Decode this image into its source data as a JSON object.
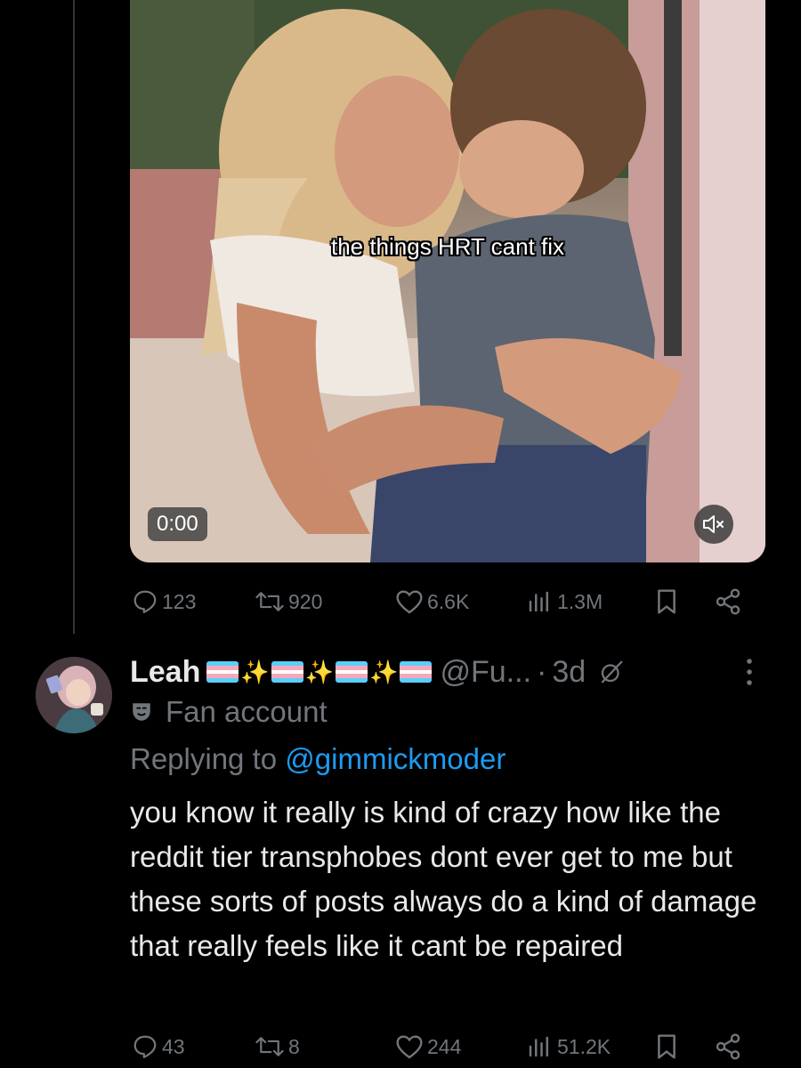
{
  "main_tweet": {
    "video": {
      "caption": "the things HRT cant fix",
      "timestamp": "0:00",
      "mute_icon": "speaker-muted-icon"
    },
    "actions": {
      "replies": "123",
      "reposts": "920",
      "likes": "6.6K",
      "views": "1.3M"
    }
  },
  "reply_tweet": {
    "display_name": "Leah",
    "name_emojis": [
      "trans-flag",
      "sparkles",
      "trans-flag",
      "sparkles",
      "trans-flag",
      "sparkles",
      "trans-flag"
    ],
    "handle": "@Fu...",
    "separator": "·",
    "time_ago": "3d",
    "account_label": "Fan account",
    "replying_prefix": "Replying to",
    "replying_to": "@gimmickmoder",
    "text": "you know it really is kind of crazy how like the reddit tier transphobes dont ever get to me but these sorts of posts always do a kind of damage that really feels like it cant be repaired",
    "actions": {
      "replies": "43",
      "reposts": "8",
      "likes": "244",
      "views": "51.2K"
    }
  },
  "colors": {
    "background": "#000000",
    "primary_text": "#e7e9ea",
    "secondary_text": "#71767b",
    "link": "#1d9bf0",
    "trans_blue": "#5bcefa",
    "trans_pink": "#f5a9b8",
    "trans_white": "#ffffff"
  }
}
